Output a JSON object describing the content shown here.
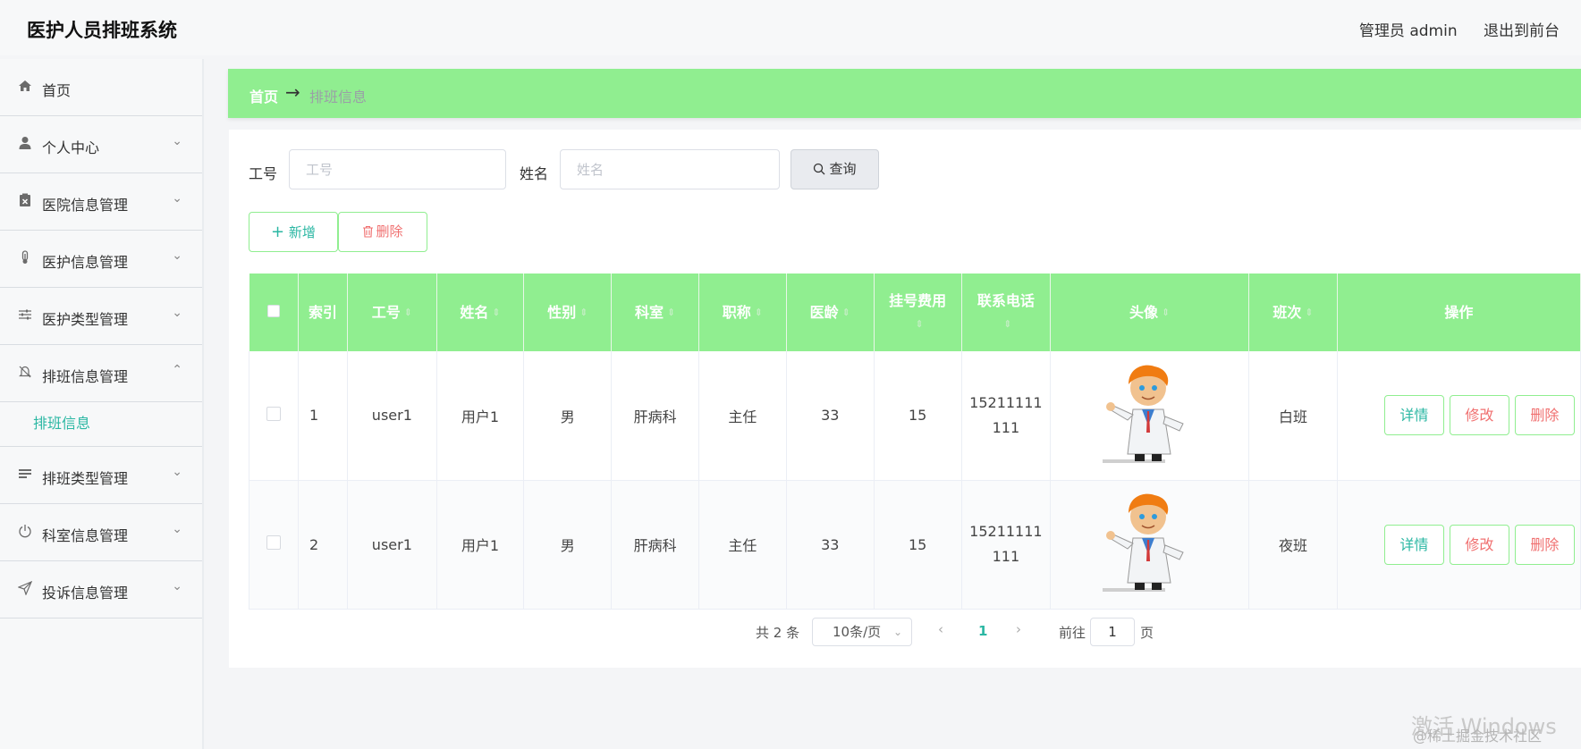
{
  "header": {
    "title": "医护人员排班系统",
    "user_label": "管理员 admin",
    "logout_label": "退出到前台"
  },
  "sidebar": {
    "items": [
      {
        "label": "首页",
        "icon": "home-icon"
      },
      {
        "label": "个人中心",
        "icon": "user-icon"
      },
      {
        "label": "医院信息管理",
        "icon": "clipboard-x-icon"
      },
      {
        "label": "医护信息管理",
        "icon": "thermometer-icon"
      },
      {
        "label": "医护类型管理",
        "icon": "sliders-icon"
      },
      {
        "label": "排班信息管理",
        "icon": "bell-off-icon"
      },
      {
        "label": "排班类型管理",
        "icon": "list-icon"
      },
      {
        "label": "科室信息管理",
        "icon": "power-icon"
      },
      {
        "label": "投诉信息管理",
        "icon": "send-icon"
      }
    ],
    "sub_item": "排班信息"
  },
  "breadcrumb": {
    "home": "首页",
    "separator": "→",
    "current": "排班信息"
  },
  "search": {
    "job_label": "工号",
    "job_placeholder": "工号",
    "name_label": "姓名",
    "name_placeholder": "姓名",
    "query_label": "查询"
  },
  "actions": {
    "add_label": "新增",
    "delete_label": "删除"
  },
  "table": {
    "headers": {
      "index": "索引",
      "job": "工号",
      "name": "姓名",
      "gender": "性别",
      "dept": "科室",
      "title": "职称",
      "age": "医龄",
      "fee_l1": "挂号费用",
      "phone_l1": "联系电话",
      "avatar": "头像",
      "shift": "班次",
      "ops": "操作"
    },
    "rows": [
      {
        "index": "1",
        "job": "user1",
        "name": "用户1",
        "gender": "男",
        "dept": "肝病科",
        "title": "主任",
        "age": "33",
        "fee": "15",
        "phone_a": "15211111",
        "phone_b": "111",
        "shift": "白班"
      },
      {
        "index": "2",
        "job": "user1",
        "name": "用户1",
        "gender": "男",
        "dept": "肝病科",
        "title": "主任",
        "age": "33",
        "fee": "15",
        "phone_a": "15211111",
        "phone_b": "111",
        "shift": "夜班"
      }
    ],
    "op_labels": {
      "detail": "详情",
      "edit": "修改",
      "delete": "删除"
    }
  },
  "pagination": {
    "total": "共 2 条",
    "page_size": "10条/页",
    "current_page": "1",
    "goto_label": "前往",
    "goto_value": "1",
    "page_suffix": "页"
  },
  "watermark": {
    "line1": "激活 Windows",
    "line2": "@稀土掘金技术社区"
  },
  "colors": {
    "accent_green": "#90ee90",
    "teal": "#2bb7a3",
    "danger": "#f07070"
  }
}
